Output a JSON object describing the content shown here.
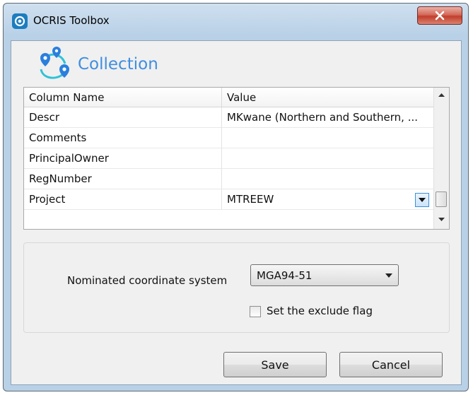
{
  "window": {
    "title": "OCRIS Toolbox",
    "close_icon": "close-x-icon"
  },
  "section": {
    "icon": "location-pins-icon",
    "title": "Collection"
  },
  "grid": {
    "headers": [
      "Column Name",
      "Value"
    ],
    "rows": [
      {
        "name": "Descr",
        "value": "MKwane (Northern and Southern, ..."
      },
      {
        "name": "Comments",
        "value": ""
      },
      {
        "name": "PrincipalOwner",
        "value": ""
      },
      {
        "name": "RegNumber",
        "value": ""
      },
      {
        "name": "Project",
        "value": "MTREEW"
      }
    ]
  },
  "settings": {
    "coord_label": "Nominated coordinate system",
    "coord_value": "MGA94-51",
    "exclude_label": "Set the exclude flag",
    "exclude_checked": "false"
  },
  "buttons": {
    "save": "Save",
    "cancel": "Cancel"
  },
  "colors": {
    "accent": "#3f8ee0",
    "title_bar": "#b9d1e7",
    "close_button": "#c9503e"
  }
}
